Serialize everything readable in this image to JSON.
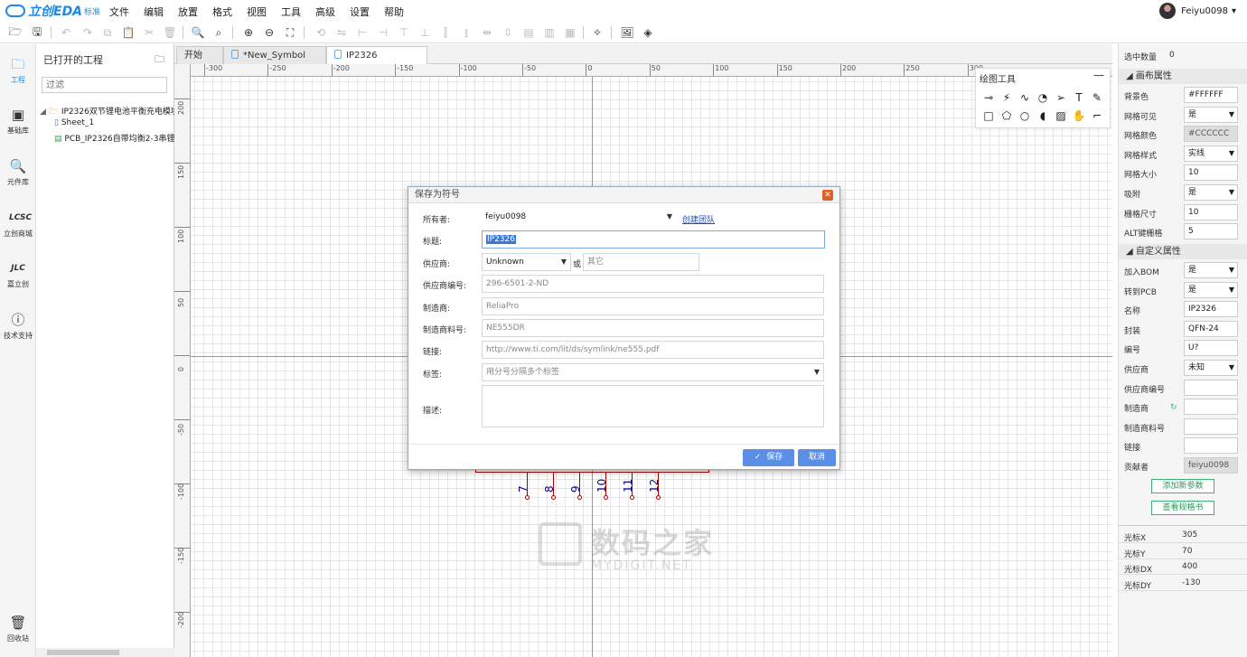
{
  "app": {
    "logo": "立创EDA",
    "logo_sub": "标准"
  },
  "menu": [
    "文件",
    "编辑",
    "放置",
    "格式",
    "视图",
    "工具",
    "高级",
    "设置",
    "帮助"
  ],
  "user": {
    "name": "Feiyu0098",
    "caret": "▾"
  },
  "leftbar": [
    {
      "label": "工程",
      "icon": "project-icon"
    },
    {
      "label": "基础库",
      "icon": "basic-lib-icon"
    },
    {
      "label": "元件库",
      "icon": "component-lib-icon"
    },
    {
      "label": "立创商城",
      "icon": "lcsc-icon"
    },
    {
      "label": "嘉立创",
      "icon": "jlc-icon"
    },
    {
      "label": "技术支持",
      "icon": "help-icon"
    },
    {
      "label": "回收站",
      "icon": "trash-icon"
    }
  ],
  "project_panel": {
    "title": "已打开的工程",
    "filter_placeholder": "过滤",
    "tree": {
      "root": "IP2326双节锂电池平衡充电模块 -",
      "sheet": "Sheet_1",
      "pcb": "PCB_IP2326自带均衡2-3串锂电"
    }
  },
  "tabs": [
    {
      "label": "开始"
    },
    {
      "label": "*New_Symbol"
    },
    {
      "label": "IP2326"
    }
  ],
  "ruler": {
    "h": [
      "-300",
      "-250",
      "-200",
      "-150",
      "-100",
      "-50",
      "0",
      "50",
      "100",
      "150",
      "200",
      "250",
      "300"
    ],
    "v": [
      "200",
      "150",
      "100",
      "50",
      "0",
      "-50",
      "-100",
      "-150",
      "-200"
    ]
  },
  "draw_tools": {
    "title": "绘图工具",
    "minimize": "—"
  },
  "pins": [
    "7",
    "8",
    "9",
    "10",
    "11",
    "12"
  ],
  "dialog": {
    "title": "保存为符号",
    "close": "✕",
    "fields": {
      "owner": {
        "label": "所有者:",
        "value": "feiyu0098",
        "link": "创建团队"
      },
      "title": {
        "label": "标题:",
        "value": "IP2326"
      },
      "supplier": {
        "label": "供应商:",
        "value": "Unknown",
        "or": "或",
        "other": "其它"
      },
      "supplier_no": {
        "label": "供应商编号:",
        "placeholder": "296-6501-2-ND"
      },
      "manufacturer": {
        "label": "制造商:",
        "placeholder": "ReliaPro"
      },
      "mfr_part": {
        "label": "制造商料号:",
        "placeholder": "NE555DR"
      },
      "link": {
        "label": "链接:",
        "placeholder": "http://www.ti.com/lit/ds/symlink/ne555.pdf"
      },
      "tags": {
        "label": "标签:",
        "placeholder": "用分号分隔多个标签"
      },
      "desc": {
        "label": "描述:"
      }
    },
    "save": "保存",
    "cancel": "取消"
  },
  "right_panel": {
    "selected": {
      "label": "选中数量",
      "value": "0"
    },
    "canvas_section": "画布属性",
    "canvas": [
      {
        "label": "背景色",
        "value": "#FFFFFF"
      },
      {
        "label": "网格可见",
        "value": "是",
        "select": true
      },
      {
        "label": "网格颜色",
        "value": "#CCCCCC",
        "grey": true
      },
      {
        "label": "网格样式",
        "value": "实线",
        "select": true
      },
      {
        "label": "网格大小",
        "value": "10"
      },
      {
        "label": "吸附",
        "value": "是",
        "select": true
      },
      {
        "label": "栅格尺寸",
        "value": "10"
      },
      {
        "label": "ALT键栅格",
        "value": "5"
      }
    ],
    "custom_section": "自定义属性",
    "custom": [
      {
        "label": "加入BOM",
        "value": "是",
        "select": true
      },
      {
        "label": "转到PCB",
        "value": "是",
        "select": true
      },
      {
        "label": "名称",
        "value": "IP2326"
      },
      {
        "label": "封装",
        "value": "QFN-24"
      },
      {
        "label": "编号",
        "value": "U?"
      },
      {
        "label": "供应商",
        "value": "未知",
        "select": true
      },
      {
        "label": "供应商编号",
        "value": ""
      },
      {
        "label": "制造商",
        "value": ""
      },
      {
        "label": "制造商料号",
        "value": ""
      },
      {
        "label": "链接",
        "value": ""
      },
      {
        "label": "贡献者",
        "value": "feiyu0098",
        "grey": true
      }
    ],
    "add_param": "添加新参数",
    "view_spec": "查看规格书",
    "cursor": [
      {
        "label": "光标X",
        "value": "305"
      },
      {
        "label": "光标Y",
        "value": "70"
      },
      {
        "label": "光标DX",
        "value": "400"
      },
      {
        "label": "光标DY",
        "value": "-130"
      }
    ]
  },
  "watermark": {
    "big": "数码之家",
    "small": "MYDIGIT.NET"
  }
}
